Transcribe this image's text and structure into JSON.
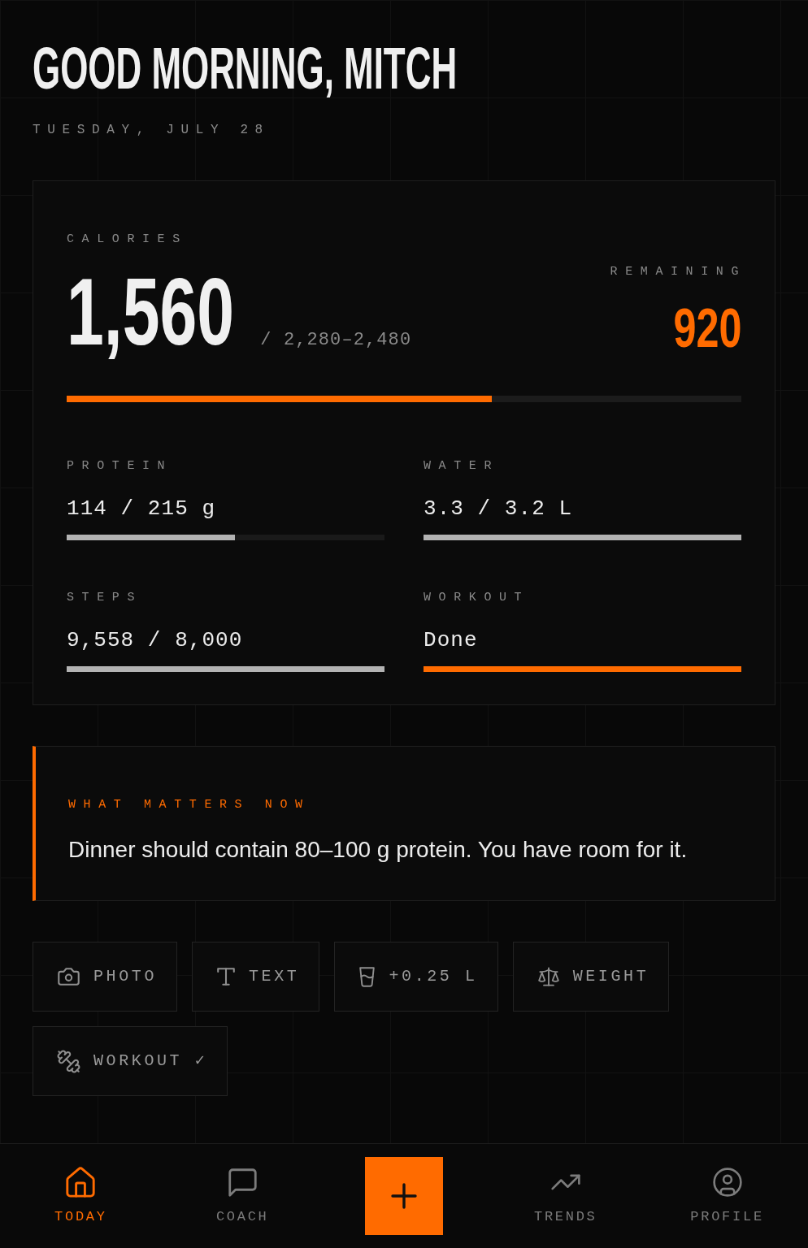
{
  "greeting": {
    "title": "GOOD MORNING, MITCH",
    "date": "TUESDAY, JULY 28"
  },
  "calories": {
    "label": "CALORIES",
    "value": "1,560",
    "target": "/ 2,280–2,480",
    "remaining_label": "REMAINING",
    "remaining_value": "920",
    "level": 0.63
  },
  "metrics": [
    {
      "label": "PROTEIN",
      "value": "114 / 215 g",
      "level": 0.53,
      "color": "#b3b3b3"
    },
    {
      "label": "WATER",
      "value": "3.3 / 3.2 L",
      "level": 1,
      "color": "#b3b3b3"
    },
    {
      "label": "STEPS",
      "value": "9,558 / 8,000",
      "level": 1,
      "color": "#b3b3b3"
    },
    {
      "label": "WORKOUT",
      "value": "Done",
      "level": 1,
      "color": "#ff6b00"
    }
  ],
  "insight": {
    "title": "WHAT MATTERS NOW",
    "text": "Dinner should contain 80–100 g protein. You have room for it."
  },
  "quick_actions": [
    {
      "kind": "photo",
      "label": "PHOTO"
    },
    {
      "kind": "text",
      "label": "TEXT"
    },
    {
      "kind": "water",
      "label": "+0.25 L"
    },
    {
      "kind": "weight",
      "label": "WEIGHT"
    },
    {
      "kind": "workout",
      "label": "WORKOUT ✓"
    }
  ],
  "nav": [
    {
      "kind": "today",
      "label": "TODAY",
      "selected": true
    },
    {
      "kind": "coach",
      "label": "COACH",
      "selected": false
    },
    {
      "kind": "add"
    },
    {
      "kind": "trends",
      "label": "TRENDS",
      "selected": false
    },
    {
      "kind": "profile",
      "label": "PROFILE",
      "selected": false
    }
  ]
}
